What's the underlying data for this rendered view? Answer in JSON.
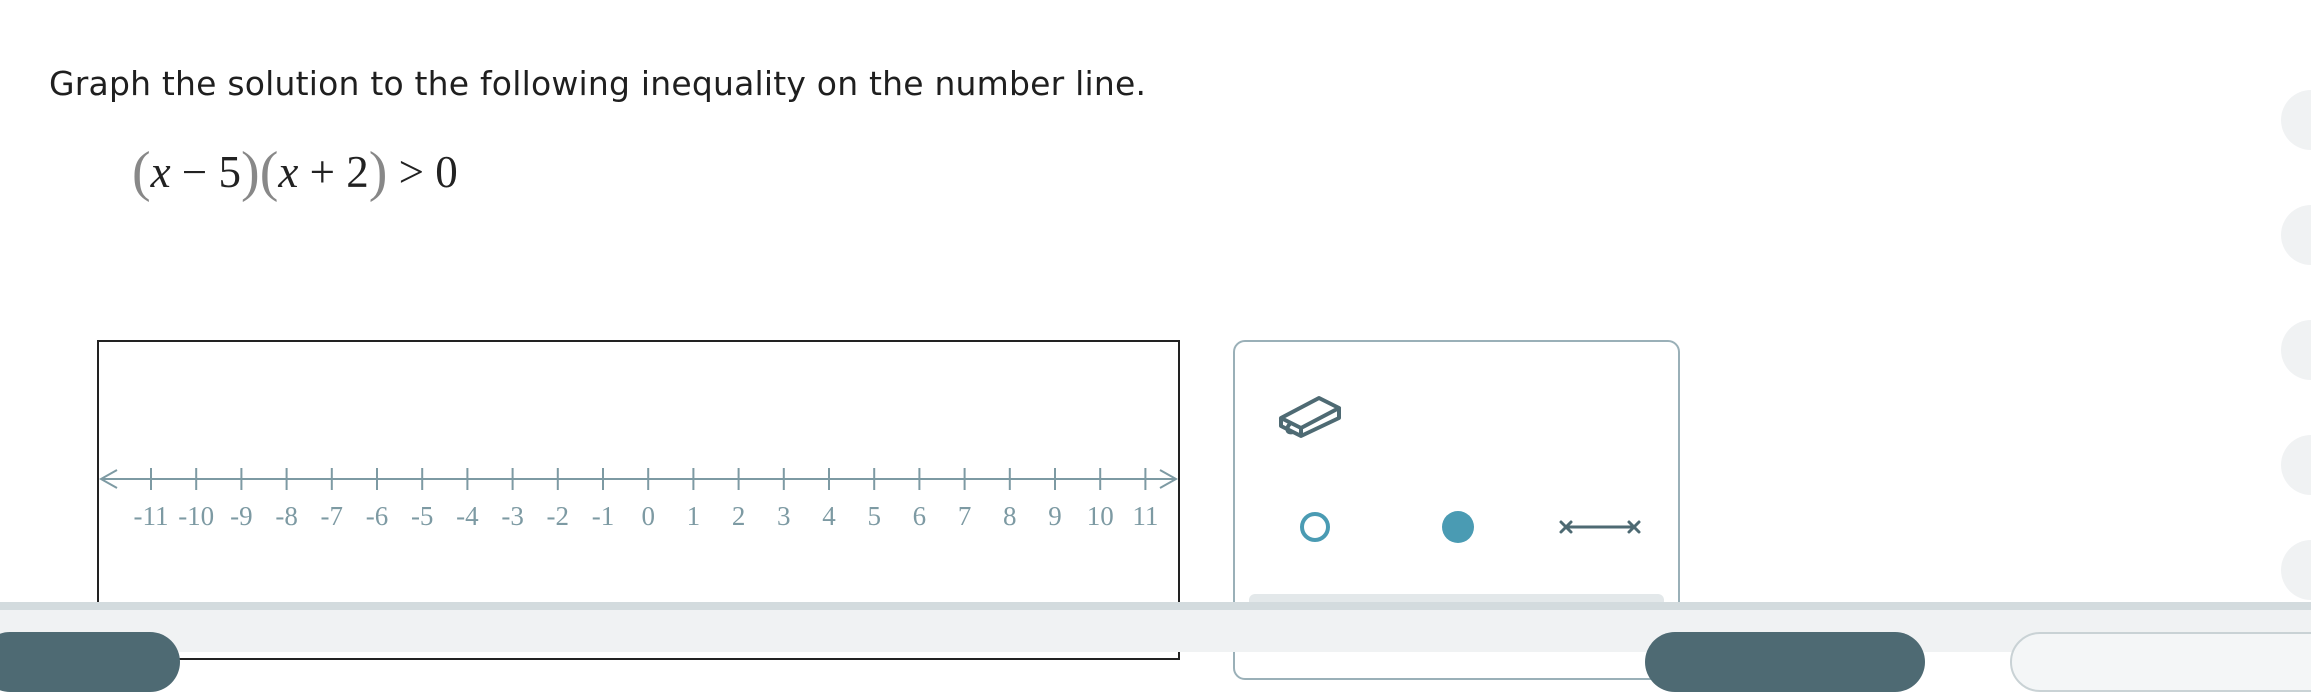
{
  "question": {
    "prompt": "Graph the solution to the following inequality on the number line."
  },
  "inequality": {
    "open1": "(",
    "term1": "x",
    "op1": " − 5",
    "close1": ")",
    "open2": "(",
    "term2": "x",
    "op2": " + 2",
    "close2": ")",
    "relation": " > 0"
  },
  "number_line": {
    "min": -11,
    "max": 11,
    "tick_labels": [
      "-11",
      "-10",
      "-9",
      "-8",
      "-7",
      "-6",
      "-5",
      "-4",
      "-3",
      "-2",
      "-1",
      "0",
      "1",
      "2",
      "3",
      "4",
      "5",
      "6",
      "7",
      "8",
      "9",
      "10",
      "11"
    ],
    "color": "#7d9aa3"
  },
  "tools": [
    {
      "name": "eraser-icon"
    },
    {
      "name": "open-circle-icon"
    },
    {
      "name": "closed-circle-icon"
    },
    {
      "name": "segment-icon"
    }
  ],
  "colors": {
    "accent": "#4a9bb3",
    "tool_icon": "#4e6a73",
    "footer_button": "#4e6a73"
  }
}
